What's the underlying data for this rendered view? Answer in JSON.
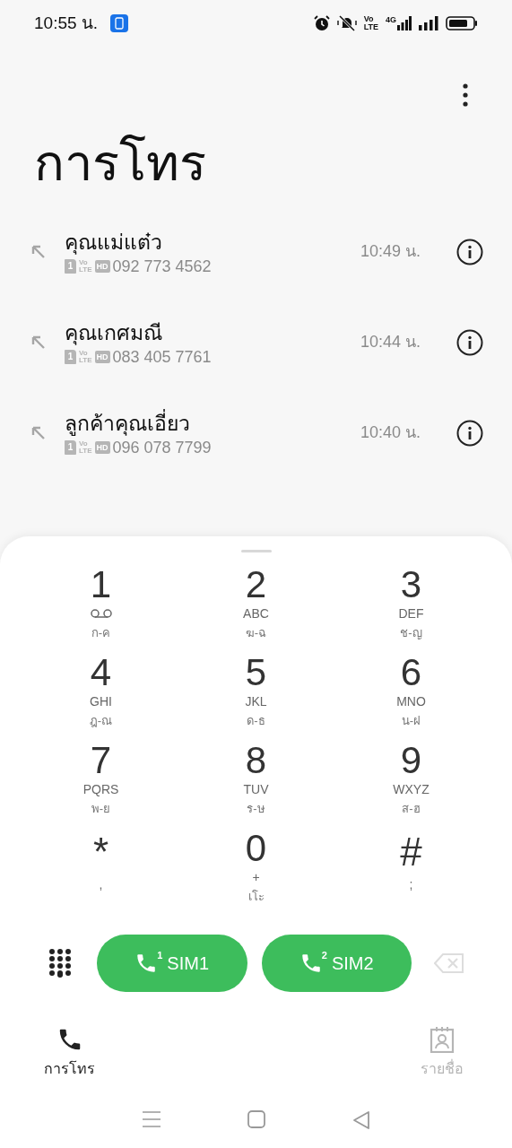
{
  "status_bar": {
    "time": "10:55 น.",
    "volte": [
      "Vo",
      "LTE"
    ],
    "network": "4G"
  },
  "title": "การโทร",
  "calls": [
    {
      "name": "คุณแม่แต๋ว",
      "sim": "1",
      "volte": [
        "Vo",
        "LTE"
      ],
      "hd": "HD",
      "number": "092 773 4562",
      "time": "10:49 น."
    },
    {
      "name": "คุณเกศมณี",
      "sim": "1",
      "volte": [
        "Vo",
        "LTE"
      ],
      "hd": "HD",
      "number": "083 405 7761",
      "time": "10:44 น."
    },
    {
      "name": "ลูกค้าคุณเอี่ยว",
      "sim": "1",
      "volte": [
        "Vo",
        "LTE"
      ],
      "hd": "HD",
      "number": "096 078 7799",
      "time": "10:40 น."
    }
  ],
  "keypad": [
    {
      "digit": "1",
      "kind": "voicemail",
      "thai": "ก-ค"
    },
    {
      "digit": "2",
      "letters": "ABC",
      "thai": "ฆ-ฉ"
    },
    {
      "digit": "3",
      "letters": "DEF",
      "thai": "ช-ญ"
    },
    {
      "digit": "4",
      "letters": "GHI",
      "thai": "ฎ-ณ"
    },
    {
      "digit": "5",
      "letters": "JKL",
      "thai": "ด-ธ"
    },
    {
      "digit": "6",
      "letters": "MNO",
      "thai": "น-ฝ"
    },
    {
      "digit": "7",
      "letters": "PQRS",
      "thai": "พ-ย"
    },
    {
      "digit": "8",
      "letters": "TUV",
      "thai": "ร-ษ"
    },
    {
      "digit": "9",
      "letters": "WXYZ",
      "thai": "ส-ฮ"
    },
    {
      "digit": "*",
      "letters": ","
    },
    {
      "digit": "0",
      "letters": "+",
      "thai": "เโะ"
    },
    {
      "digit": "#",
      "letters": ";"
    }
  ],
  "call_buttons": [
    {
      "slot": "1",
      "label": "SIM1"
    },
    {
      "slot": "2",
      "label": "SIM2"
    }
  ],
  "tabs": [
    {
      "label": "การโทร",
      "kind": "phone",
      "selected": true
    },
    {
      "label": "รายชื่อ",
      "kind": "contacts",
      "selected": false
    }
  ]
}
